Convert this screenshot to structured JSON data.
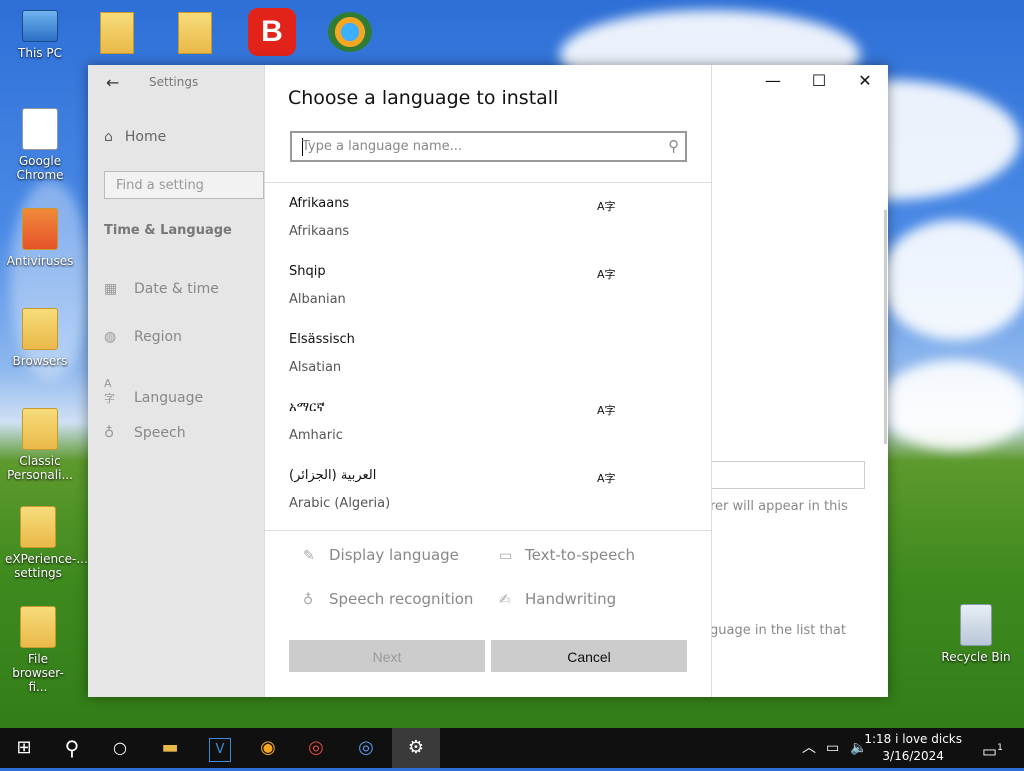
{
  "desktop": {
    "icons": [
      {
        "label": "This PC"
      },
      {
        "label": "Google Chrome"
      },
      {
        "label": "Antiviruses"
      },
      {
        "label": "Browsers"
      },
      {
        "label": "Classic Personali..."
      },
      {
        "label": "eXPerience-... settings"
      },
      {
        "label": "File browser-fi..."
      },
      {
        "label": "Recycle Bin"
      }
    ]
  },
  "settings": {
    "app_title": "Settings",
    "home": "Home",
    "search_placeholder": "Find a setting",
    "section": "Time & Language",
    "nav": [
      {
        "label": "Date & time",
        "icon": "calendar-icon"
      },
      {
        "label": "Region",
        "icon": "globe-icon"
      },
      {
        "label": "Language",
        "icon": "language-icon"
      },
      {
        "label": "Speech",
        "icon": "microphone-icon"
      }
    ],
    "right_text_1": "rer will appear in this",
    "right_text_2": "guage in the list that"
  },
  "dialog": {
    "title": "Choose a language to install",
    "search_placeholder": "Type a language name...",
    "languages": [
      {
        "native": "Afrikaans",
        "english": "Afrikaans",
        "has_feature": true
      },
      {
        "native": "Shqip",
        "english": "Albanian",
        "has_feature": true
      },
      {
        "native": "Elsässisch",
        "english": "Alsatian",
        "has_feature": false
      },
      {
        "native": "አማርኛ",
        "english": "Amharic",
        "has_feature": true
      },
      {
        "native": "العربية (الجزائر)",
        "english": "Arabic (Algeria)",
        "has_feature": true
      }
    ],
    "feature_glyph": "A字",
    "features": {
      "display_language": "Display language",
      "text_to_speech": "Text-to-speech",
      "speech_recognition": "Speech recognition",
      "handwriting": "Handwriting"
    },
    "next_label": "Next",
    "cancel_label": "Cancel"
  },
  "taskbar": {
    "time": "1:18 i love dicks",
    "date": "3/16/2024",
    "notification_count": "1"
  }
}
